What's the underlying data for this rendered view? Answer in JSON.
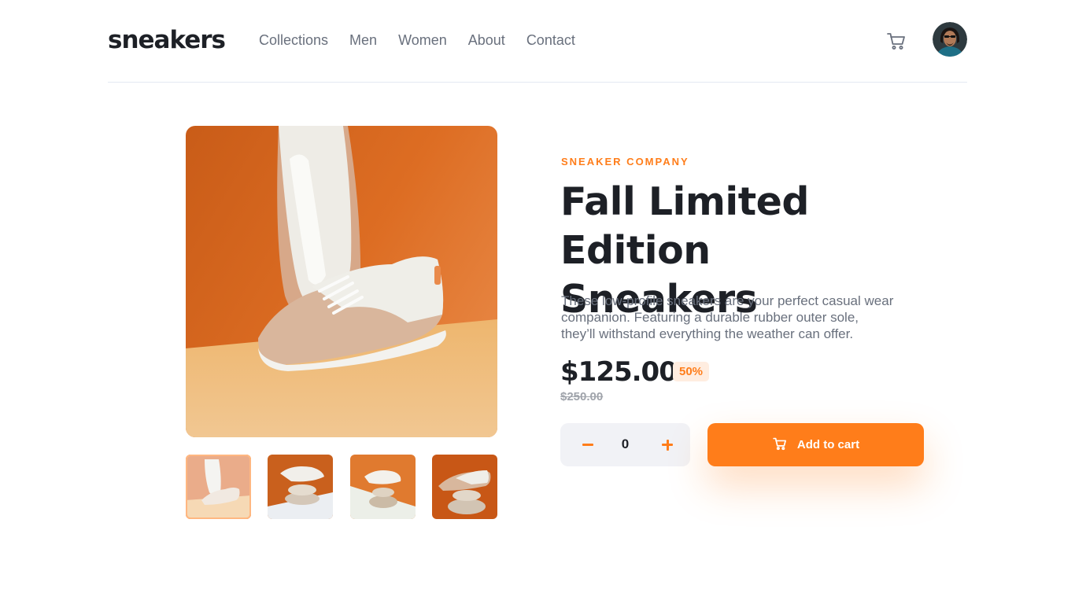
{
  "header": {
    "logo": "sneakers",
    "nav": [
      "Collections",
      "Men",
      "Women",
      "About",
      "Contact"
    ]
  },
  "icons": {
    "cart": "cart-icon",
    "avatar": "user-avatar"
  },
  "colors": {
    "accent": "#ff7d1a",
    "accent_light": "#ffede0",
    "dark": "#1d2026",
    "gray": "#69707d"
  },
  "product": {
    "company": "SNEAKER COMPANY",
    "title_line1": "Fall Limited Edition",
    "title_line2": "Sneakers",
    "description_line1": "These low-profile sneakers are your perfect casual wear",
    "description_line2": "companion. Featuring a durable rubber outer sole,",
    "description_line3": "they’ll withstand everything the weather can offer.",
    "price": "$125.00",
    "discount": "50%",
    "old_price": "$250.00",
    "quantity": "0",
    "add_to_cart": "Add to cart"
  }
}
